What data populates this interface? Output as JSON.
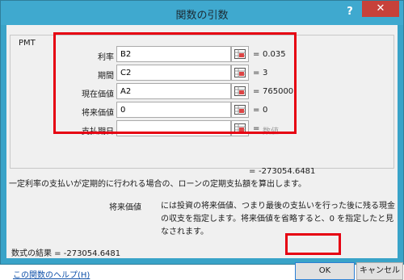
{
  "window": {
    "title": "関数の引数",
    "help_glyph": "?",
    "close_glyph": "✕"
  },
  "function_group": {
    "name": "PMT"
  },
  "arguments": [
    {
      "label": "利率",
      "value": "B2",
      "placeholder": "",
      "result": "0.035"
    },
    {
      "label": "期間",
      "value": "C2",
      "placeholder": "",
      "result": "3"
    },
    {
      "label": "現在価値",
      "value": "A2",
      "placeholder": "",
      "result": "765000"
    },
    {
      "label": "将来価値",
      "value": "0",
      "placeholder": "",
      "result": "0"
    },
    {
      "label": "支払期日",
      "value": "",
      "placeholder": "",
      "result": "数値"
    }
  ],
  "equals_sign": "=",
  "function_result": "-273054.6481",
  "description": "一定利率の支払いが定期的に行われる場合の、ローンの定期支払額を算出します。",
  "current_argument": {
    "name": "将来価値",
    "description": "には投資の将来価値、つまり最後の支払いを行った後に残る現金の収支を指定します。将来価値を省略すると、0 を指定したと見なされます。"
  },
  "formula_result": "数式の結果 =  -273054.6481",
  "help_link": "この関数のヘルプ(H)",
  "buttons": {
    "ok": "OK",
    "cancel": "キャンセル"
  },
  "colors": {
    "titlebar": "#3fa9cf",
    "close_button": "#c7413a",
    "highlight": "#e60012",
    "link": "#0d4fa8"
  }
}
